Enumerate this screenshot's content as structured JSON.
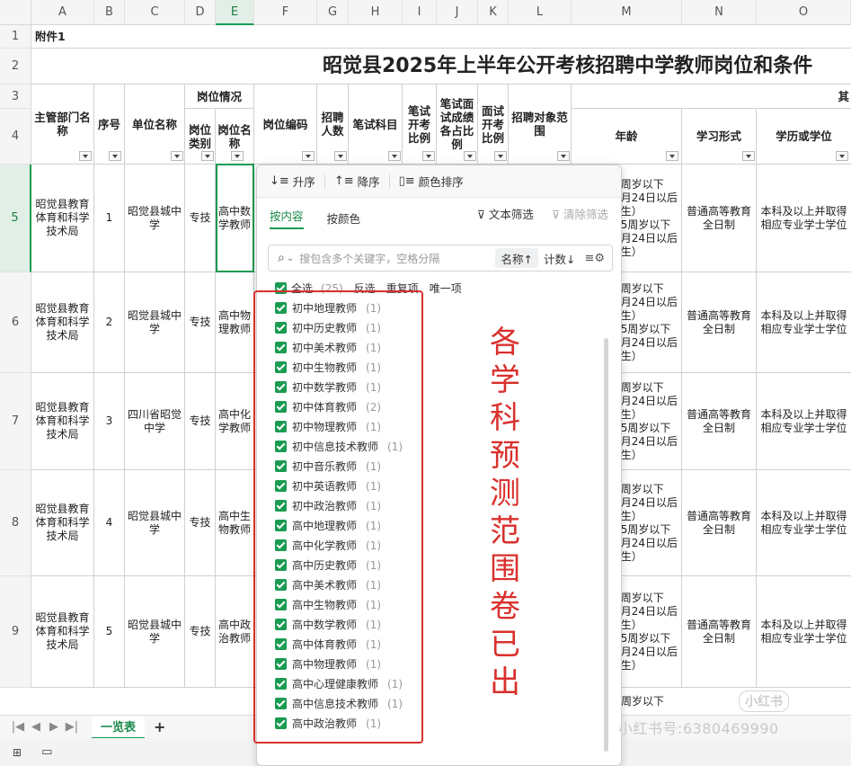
{
  "columns": [
    "A",
    "B",
    "C",
    "D",
    "E",
    "F",
    "G",
    "H",
    "I",
    "J",
    "K",
    "L",
    "M",
    "N",
    "O"
  ],
  "rows": [
    "1",
    "2",
    "3",
    "4",
    "5",
    "6",
    "7",
    "8",
    "9"
  ],
  "sheet": {
    "attachment": "附件1",
    "title": "昭觉县2025年上半年公开考核招聘中学教师岗位和条件",
    "headers": {
      "dept": "主管部门名称",
      "seq": "序号",
      "unit": "单位名称",
      "post_info": "岗位情况",
      "post_type": "岗位类别",
      "post_name": "岗位名称",
      "post_code": "岗位编码",
      "hire_count": "招聘人数",
      "exam_subject": "笔试科目",
      "exam_ratio": "笔试开考比例",
      "interview_weight": "笔试面试成绩各占比例",
      "interview_ratio": "面试开考比例",
      "target": "招聘对象范围",
      "other": "其",
      "age": "年龄",
      "study_form": "学习形式",
      "degree": "学历或学位"
    },
    "data_rows": [
      {
        "dept": "昭觉县教育体育和科学技术局",
        "seq": "1",
        "unit": "昭觉县城中学",
        "type": "专技",
        "name": "高中数学教师",
        "age": "周岁以下\n月24日以后\n生）\n5周岁以下\n月24日以后\n生）",
        "form": "普通高等教育全日制",
        "degree": "本科及以上并取得相应专业学士学位"
      },
      {
        "dept": "昭觉县教育体育和科学技术局",
        "seq": "2",
        "unit": "昭觉县城中学",
        "type": "专技",
        "name": "高中物理教师",
        "age": "周岁以下\n月24日以后\n生）\n5周岁以下\n月24日以后\n生）",
        "form": "普通高等教育全日制",
        "degree": "本科及以上并取得相应专业学士学位"
      },
      {
        "dept": "昭觉县教育体育和科学技术局",
        "seq": "3",
        "unit": "四川省昭觉中学",
        "type": "专技",
        "name": "高中化学教师",
        "age": "周岁以下\n月24日以后\n生）\n5周岁以下\n月24日以后\n生）",
        "form": "普通高等教育全日制",
        "degree": "本科及以上并取得相应专业学士学位"
      },
      {
        "dept": "昭觉县教育体育和科学技术局",
        "seq": "4",
        "unit": "昭觉县城中学",
        "type": "专技",
        "name": "高中生物教师",
        "age": "周岁以下\n月24日以后\n生）\n5周岁以下\n月24日以后\n生）",
        "form": "普通高等教育全日制",
        "degree": "本科及以上并取得相应专业学士学位"
      },
      {
        "dept": "昭觉县教育体育和科学技术局",
        "seq": "5",
        "unit": "昭觉县城中学",
        "type": "专技",
        "name": "高中政治教师",
        "age": "周岁以下\n月24日以后\n生）\n5周岁以下\n月24日以后\n生）",
        "form": "普通高等教育全日制",
        "degree": "本科及以上并取得相应专业学士学位"
      }
    ],
    "row10_age": "周岁以下"
  },
  "filter_panel": {
    "sort_asc": "升序",
    "sort_desc": "降序",
    "sort_color": "颜色排序",
    "tab_content": "按内容",
    "tab_color": "按颜色",
    "text_filter": "文本筛选",
    "clear_filter": "清除筛选",
    "search_placeholder": "搜包含多个关键字，空格分隔",
    "order_name": "名称↑",
    "order_count": "计数↓",
    "select_all": "全选",
    "select_all_count": "(25)",
    "invert": "反选",
    "duplicates": "重复项",
    "unique": "唯一项",
    "items": [
      {
        "label": "初中地理教师",
        "count": "(1)"
      },
      {
        "label": "初中历史教师",
        "count": "(1)"
      },
      {
        "label": "初中美术教师",
        "count": "(1)"
      },
      {
        "label": "初中生物教师",
        "count": "(1)"
      },
      {
        "label": "初中数学教师",
        "count": "(1)"
      },
      {
        "label": "初中体育教师",
        "count": "(2)"
      },
      {
        "label": "初中物理教师",
        "count": "(1)"
      },
      {
        "label": "初中信息技术教师",
        "count": "(1)"
      },
      {
        "label": "初中音乐教师",
        "count": "(1)"
      },
      {
        "label": "初中英语教师",
        "count": "(1)"
      },
      {
        "label": "初中政治教师",
        "count": "(1)"
      },
      {
        "label": "高中地理教师",
        "count": "(1)"
      },
      {
        "label": "高中化学教师",
        "count": "(1)"
      },
      {
        "label": "高中历史教师",
        "count": "(1)"
      },
      {
        "label": "高中美术教师",
        "count": "(1)"
      },
      {
        "label": "高中生物教师",
        "count": "(1)"
      },
      {
        "label": "高中数学教师",
        "count": "(1)"
      },
      {
        "label": "高中体育教师",
        "count": "(1)"
      },
      {
        "label": "高中物理教师",
        "count": "(1)"
      },
      {
        "label": "高中心理健康教师",
        "count": "(1)"
      },
      {
        "label": "高中信息技术教师",
        "count": "(1)"
      },
      {
        "label": "高中政治教师",
        "count": "(1)"
      }
    ]
  },
  "overlay_text": [
    "各",
    "学",
    "科",
    "预",
    "测",
    "范",
    "围",
    "卷",
    "已",
    "出"
  ],
  "sheet_tab": "一览表",
  "add_tab": "+",
  "watermark": "小红书号:6380469990",
  "watermark_logo": "小红书",
  "colors": {
    "accent": "#1a9b52",
    "annotation": "#d9302c"
  }
}
